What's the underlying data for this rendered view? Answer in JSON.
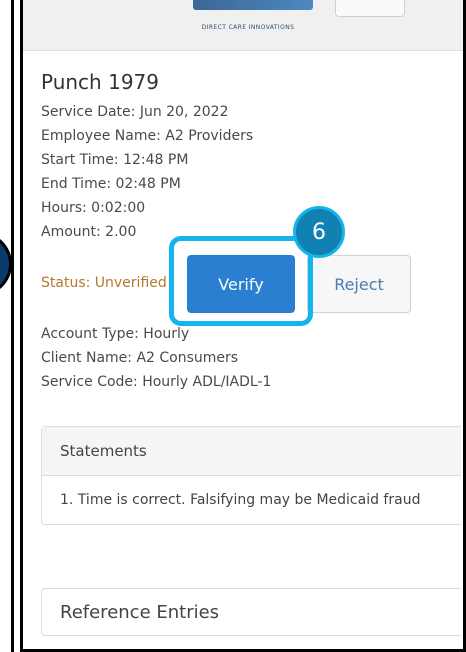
{
  "header": {
    "logo_text": "DIRECT CARE INNOVATIONS"
  },
  "punch": {
    "title": "Punch 1979",
    "service_date": "Service Date: Jun 20, 2022",
    "employee_name": "Employee Name: A2 Providers",
    "start_time": "Start Time: 12:48 PM",
    "end_time": "End Time: 02:48 PM",
    "hours": "Hours: 0:02:00",
    "amount": "Amount: 2.00",
    "status": "Status: Unverified",
    "account_type": "Account Type: Hourly",
    "client_name": "Client Name: A2 Consumers",
    "service_code": "Service Code: Hourly ADL/IADL-1"
  },
  "actions": {
    "verify_label": "Verify",
    "reject_label": "Reject"
  },
  "annotation": {
    "step_number": "6",
    "highlight_color": "#13b5ea"
  },
  "statements": {
    "heading": "Statements",
    "items": [
      "1. Time is correct. Falsifying may be Medicaid fraud"
    ]
  },
  "reference_entries": {
    "heading": "Reference Entries"
  }
}
